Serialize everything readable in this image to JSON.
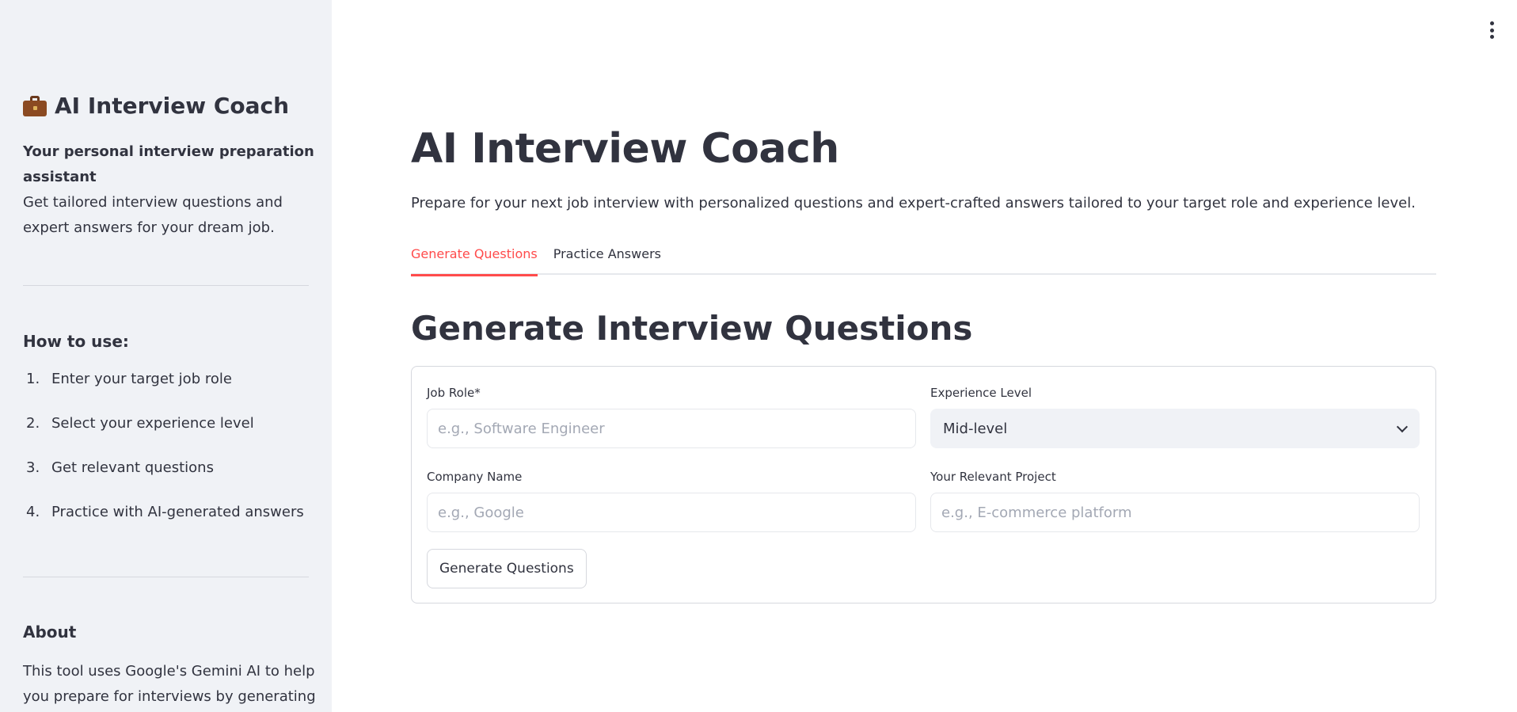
{
  "sidebar": {
    "title": "AI Interview Coach",
    "title_icon": "briefcase-icon",
    "tagline": "Your personal interview preparation assistant",
    "description": "Get tailored interview questions and expert answers for your dream job.",
    "how_to_heading": "How to use:",
    "steps": [
      {
        "num": "1.",
        "text": "Enter your target job role"
      },
      {
        "num": "2.",
        "text": "Select your experience level"
      },
      {
        "num": "3.",
        "text": "Get relevant questions"
      },
      {
        "num": "4.",
        "text": "Practice with AI-generated answers"
      }
    ],
    "about_heading": "About",
    "about_text": "This tool uses Google's Gemini AI to help you prepare for interviews by generating"
  },
  "header": {
    "menu_icon": "kebab-menu-icon"
  },
  "main": {
    "title": "AI Interview Coach",
    "description": "Prepare for your next job interview with personalized questions and expert-crafted answers tailored to your target role and experience level.",
    "tabs": [
      {
        "label": "Generate Questions",
        "active": true
      },
      {
        "label": "Practice Answers",
        "active": false
      }
    ],
    "section_title": "Generate Interview Questions",
    "form": {
      "job_role": {
        "label": "Job Role*",
        "placeholder": "e.g., Software Engineer",
        "value": ""
      },
      "experience_level": {
        "label": "Experience Level",
        "value": "Mid-level"
      },
      "company_name": {
        "label": "Company Name",
        "placeholder": "e.g., Google",
        "value": ""
      },
      "relevant_project": {
        "label": "Your Relevant Project",
        "placeholder": "e.g., E-commerce platform",
        "value": ""
      },
      "submit_label": "Generate Questions"
    }
  },
  "colors": {
    "accent": "#ff4b4b",
    "sidebar_bg": "#f0f2f6",
    "text": "#31333f"
  }
}
